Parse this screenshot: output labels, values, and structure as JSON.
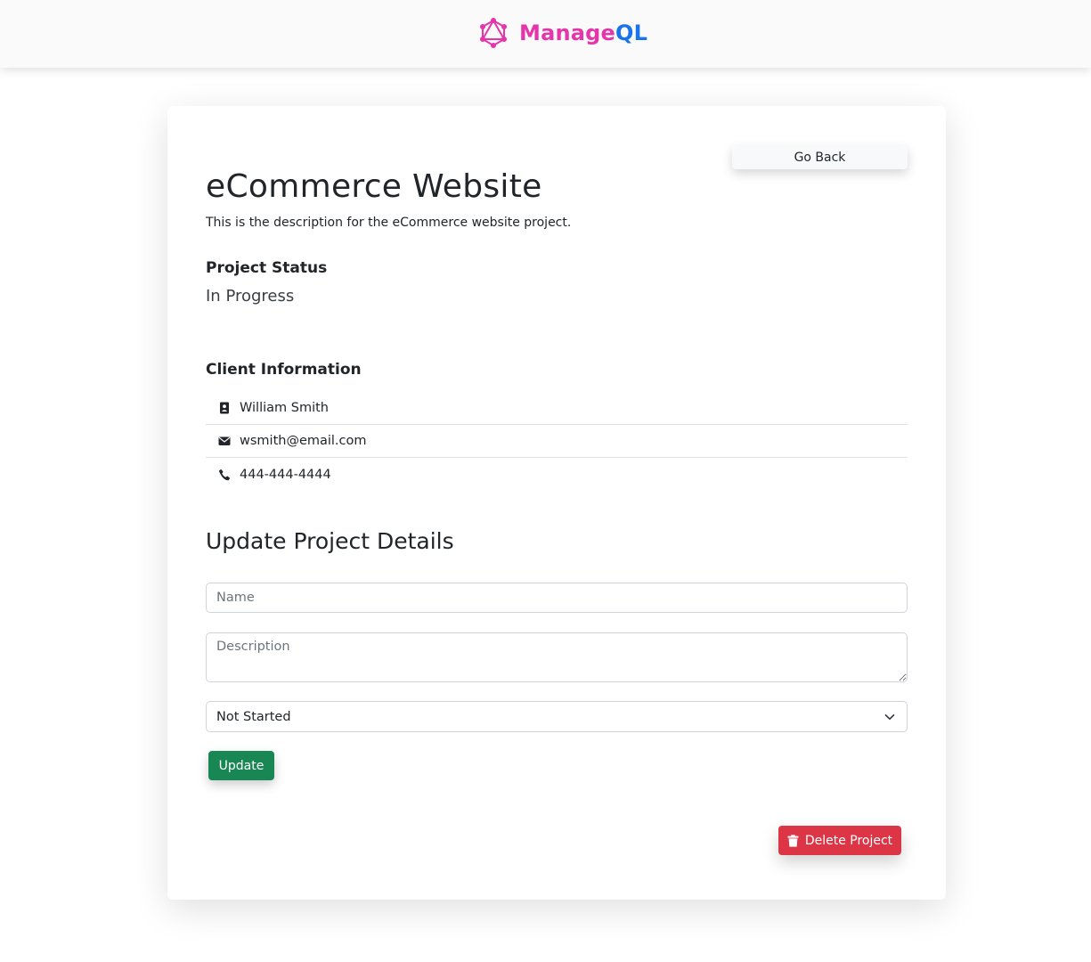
{
  "navbar": {
    "brand_part1": "Manage",
    "brand_part2": "QL",
    "logo_icon": "graphql-logo-icon",
    "brand_color_primary": "#e535ab",
    "brand_color_secondary": "#1a73e8"
  },
  "project": {
    "go_back_label": "Go Back",
    "name": "eCommerce Website",
    "description": "This is the description for the eCommerce website project.",
    "status_heading": "Project Status",
    "status_value": "In Progress"
  },
  "client": {
    "heading": "Client Information",
    "items": [
      {
        "icon": "contact-card-icon",
        "value": "William Smith"
      },
      {
        "icon": "envelope-icon",
        "value": "wsmith@email.com"
      },
      {
        "icon": "phone-icon",
        "value": "444-444-4444"
      }
    ]
  },
  "update_form": {
    "heading": "Update Project Details",
    "name_placeholder": "Name",
    "description_placeholder": "Description",
    "status_selected": "Not Started",
    "submit_label": "Update",
    "submit_color": "#198754"
  },
  "delete": {
    "label": "Delete Project",
    "icon": "trash-icon",
    "color": "#dc3545"
  }
}
